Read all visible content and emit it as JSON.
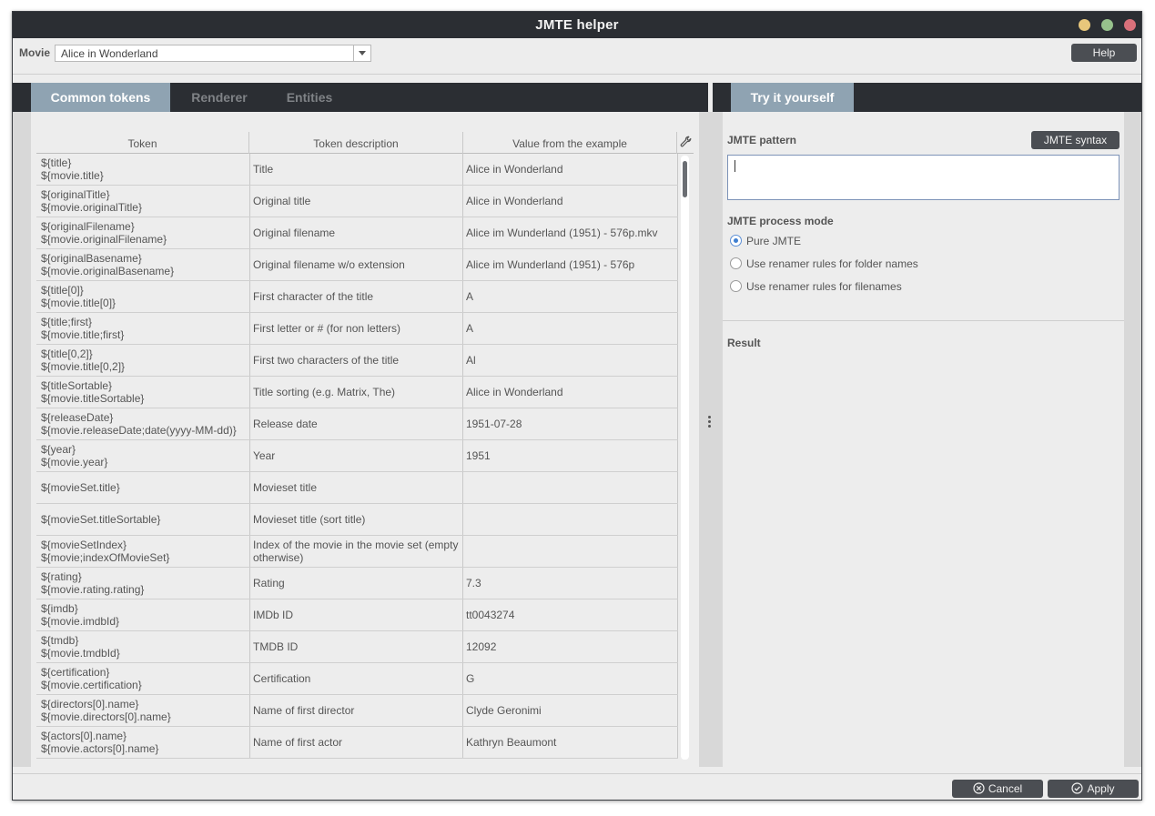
{
  "window": {
    "title": "JMTE helper"
  },
  "toolbar": {
    "movie_label": "Movie",
    "movie_value": "Alice in Wonderland",
    "help_label": "Help"
  },
  "left_tabs": [
    {
      "label": "Common tokens",
      "active": true
    },
    {
      "label": "Renderer",
      "active": false
    },
    {
      "label": "Entities",
      "active": false
    }
  ],
  "table": {
    "columns": [
      "Token",
      "Token description",
      "Value from the example"
    ],
    "rows": [
      {
        "token": [
          "${title}",
          "${movie.title}"
        ],
        "desc": "Title",
        "value": "Alice in Wonderland"
      },
      {
        "token": [
          "${originalTitle}",
          "${movie.originalTitle}"
        ],
        "desc": "Original title",
        "value": "Alice in Wonderland"
      },
      {
        "token": [
          "${originalFilename}",
          "${movie.originalFilename}"
        ],
        "desc": "Original filename",
        "value": "Alice im Wunderland (1951) - 576p.mkv"
      },
      {
        "token": [
          "${originalBasename}",
          "${movie.originalBasename}"
        ],
        "desc": "Original filename w/o extension",
        "value": "Alice im Wunderland (1951) - 576p"
      },
      {
        "token": [
          "${title[0]}",
          "${movie.title[0]}"
        ],
        "desc": "First character of the title",
        "value": "A"
      },
      {
        "token": [
          "${title;first}",
          "${movie.title;first}"
        ],
        "desc": "First letter or # (for non letters)",
        "value": "A"
      },
      {
        "token": [
          "${title[0,2]}",
          "${movie.title[0,2]}"
        ],
        "desc": "First two characters of the title",
        "value": "Al"
      },
      {
        "token": [
          "${titleSortable}",
          "${movie.titleSortable}"
        ],
        "desc": "Title sorting (e.g. Matrix, The)",
        "value": "Alice in Wonderland"
      },
      {
        "token": [
          "${releaseDate}",
          "${movie.releaseDate;date(yyyy-MM-dd)}"
        ],
        "desc": "Release date",
        "value": "1951-07-28"
      },
      {
        "token": [
          "${year}",
          "${movie.year}"
        ],
        "desc": "Year",
        "value": "1951"
      },
      {
        "token": [
          "${movieSet.title}"
        ],
        "desc": "Movieset title",
        "value": ""
      },
      {
        "token": [
          "${movieSet.titleSortable}"
        ],
        "desc": "Movieset title (sort title)",
        "value": ""
      },
      {
        "token": [
          "${movieSetIndex}",
          "${movie;indexOfMovieSet}"
        ],
        "desc": "Index of the movie in the movie set (empty otherwise)",
        "value": ""
      },
      {
        "token": [
          "${rating}",
          "${movie.rating.rating}"
        ],
        "desc": "Rating",
        "value": "7.3"
      },
      {
        "token": [
          "${imdb}",
          "${movie.imdbId}"
        ],
        "desc": "IMDb ID",
        "value": "tt0043274"
      },
      {
        "token": [
          "${tmdb}",
          "${movie.tmdbId}"
        ],
        "desc": "TMDB ID",
        "value": "12092"
      },
      {
        "token": [
          "${certification}",
          "${movie.certification}"
        ],
        "desc": "Certification",
        "value": "G"
      },
      {
        "token": [
          "${directors[0].name}",
          "${movie.directors[0].name}"
        ],
        "desc": "Name of first director",
        "value": "Clyde Geronimi"
      },
      {
        "token": [
          "${actors[0].name}",
          "${movie.actors[0].name}"
        ],
        "desc": "Name of first actor",
        "value": "Kathryn Beaumont"
      }
    ]
  },
  "right_tabs": [
    {
      "label": "Try it yourself",
      "active": true
    }
  ],
  "try": {
    "pattern_label": "JMTE pattern",
    "syntax_label": "JMTE syntax",
    "pattern_value": "",
    "mode_label": "JMTE process mode",
    "modes": [
      {
        "label": "Pure JMTE",
        "checked": true
      },
      {
        "label": "Use renamer rules for folder names",
        "checked": false
      },
      {
        "label": "Use renamer rules for filenames",
        "checked": false
      }
    ],
    "result_label": "Result"
  },
  "footer": {
    "cancel_label": "Cancel",
    "apply_label": "Apply"
  },
  "colors": {
    "titlebar": "#2b2e33",
    "active_tab": "#8fa3b2",
    "button": "#4b4e53",
    "radio_checked": "#3e7fd1"
  },
  "icons": {
    "column_settings": "wrench-icon",
    "cancel": "cancel-circle-icon",
    "apply": "check-circle-icon"
  }
}
